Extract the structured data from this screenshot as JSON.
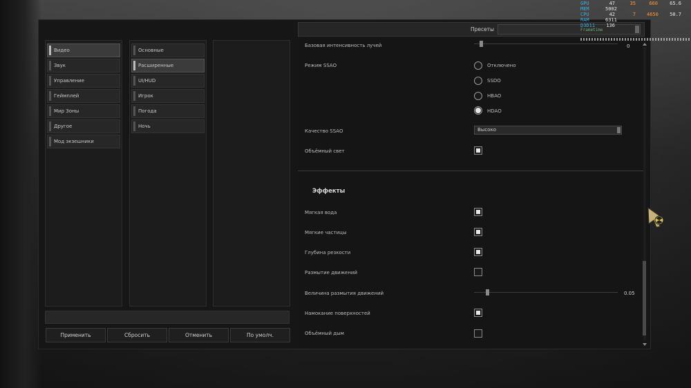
{
  "categories": [
    "Видео",
    "Звук",
    "Управление",
    "Геймплей",
    "Мир Зоны",
    "Другое",
    "Мод экзешники"
  ],
  "subcategories": [
    "Основные",
    "Расширенные",
    "UI/HUD",
    "Игрок",
    "Погода",
    "Ночь"
  ],
  "bottom_buttons": {
    "apply": "Применить",
    "reset": "Сбросить",
    "cancel": "Отменить",
    "default": "По умолч."
  },
  "presets": {
    "label": "Пресеты",
    "value": ""
  },
  "settings": {
    "sun_rays_intensity": {
      "label": "Базовая интенсивность лучей",
      "value": "0"
    },
    "ssao_mode": {
      "label": "Режим SSAO",
      "options": [
        "Отключено",
        "SSDO",
        "HBAO",
        "HDAO"
      ],
      "selected": "HDAO"
    },
    "ssao_quality": {
      "label": "Качество SSAO",
      "value": "Высоко"
    },
    "volumetric_light": {
      "label": "Объёмный свет",
      "checked": true
    },
    "effects_heading": "Эффекты",
    "soft_water": {
      "label": "Мягкая вода",
      "checked": true
    },
    "soft_particles": {
      "label": "Мягкие частицы",
      "checked": true
    },
    "depth_of_field": {
      "label": "Глубина резкости",
      "checked": true
    },
    "motion_blur": {
      "label": "Размытие движений",
      "checked": false
    },
    "motion_blur_amount": {
      "label": "Величина размытия движений",
      "value": "0.05"
    },
    "wet_surfaces": {
      "label": "Намокание поверхностей",
      "checked": true
    },
    "volumetric_smoke": {
      "label": "Объёмный дым",
      "checked": false
    }
  },
  "overlay": {
    "rows": [
      {
        "key": "GPU",
        "v1": "47",
        "v2": "35",
        "v3": "660",
        "v4": "65.6"
      },
      {
        "key": "MEM",
        "v1": "5002",
        "v2": "",
        "v3": "",
        "v4": ""
      },
      {
        "key": "CPU",
        "v1": "42",
        "v2": "7",
        "v3": "4650",
        "v4": "50.7"
      },
      {
        "key": "RAM",
        "v1": "6311",
        "v2": "",
        "v3": "",
        "v4": ""
      },
      {
        "key": "D3D11",
        "v1": "136",
        "v2": "",
        "v3": "",
        "v4": ""
      }
    ],
    "subtitle": "Frametime"
  }
}
